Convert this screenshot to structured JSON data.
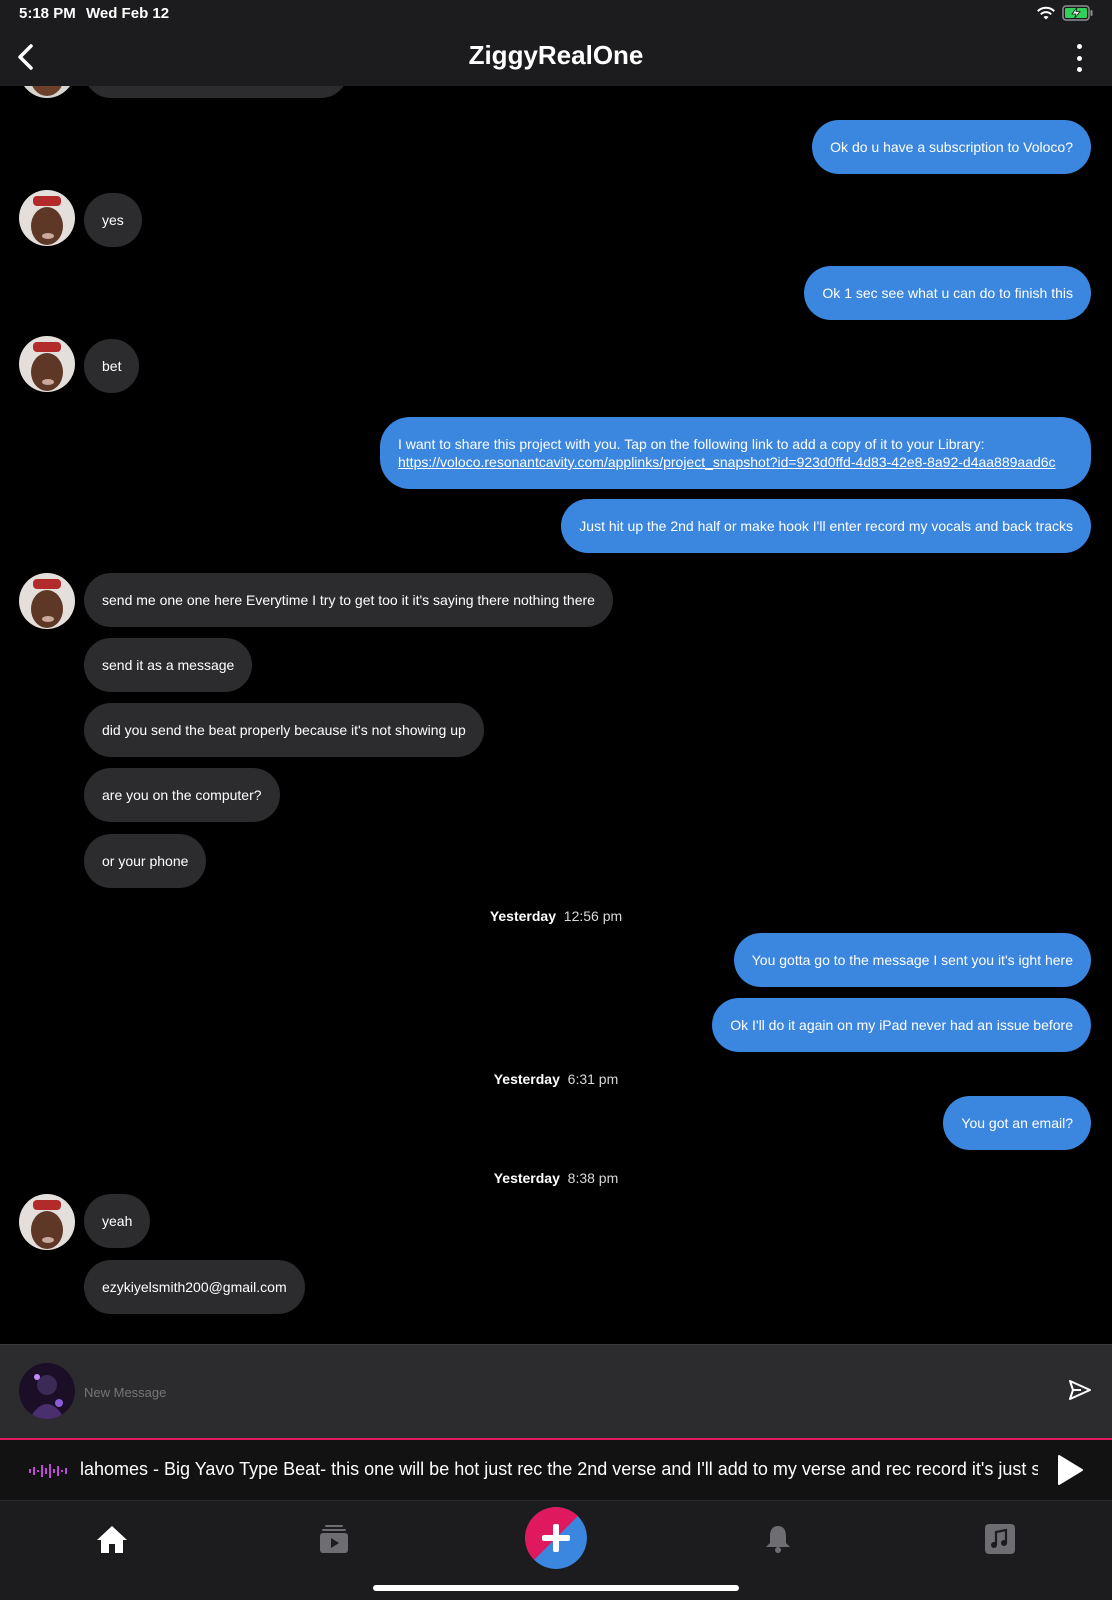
{
  "status_bar": {
    "time": "5:18 PM",
    "date": "Wed Feb 12"
  },
  "header": {
    "title": "ZiggyRealOne"
  },
  "messages": {
    "m1": "Ok do u have a subscription to Voloco?",
    "m2": "yes",
    "m3": "Ok 1 sec see what u can do to finish this",
    "m4": "bet",
    "m5_line1": "I want to share this project with you. Tap on the following link to add a copy of it to your Library:",
    "m5_link": "https://voloco.resonantcavity.com/applinks/project_snapshot?id=923d0ffd-4d83-42e8-8a92-d4aa889aad6c",
    "m6": "Just hit up the 2nd half or make hook I'll enter record my vocals and back tracks",
    "m7": "send me one one here Everytime I try to get too it it's saying there nothing there",
    "m8": "send it as a message",
    "m9": "did you send the beat properly because it's not showing up",
    "m10": "are you on the computer?",
    "m11": "or your phone",
    "ts1_day": "Yesterday",
    "ts1_time": "12:56 pm",
    "m12": "You gotta go to the message I sent you it's ight here",
    "m13": "Ok I'll do it again on my iPad never had an issue before",
    "ts2_day": "Yesterday",
    "ts2_time": "6:31 pm",
    "m14": "You got an email?",
    "ts3_day": "Yesterday",
    "ts3_time": "8:38 pm",
    "m15": "yeah",
    "m16": "ezykiyelsmith200@gmail.com"
  },
  "composer": {
    "placeholder": "New Message"
  },
  "player": {
    "track": "lahomes - Big Yavo Type Beat- this one will be hot just rec the 2nd verse and I'll add to my verse and rec record it's just sw"
  },
  "colors": {
    "outgoing": "#3b86df",
    "incoming": "#2c2c2e",
    "accent_pink": "#e0185d",
    "accent_blue": "#3b86df"
  },
  "icons": [
    "back-chevron-icon",
    "more-vertical-icon",
    "wifi-icon",
    "battery-charging-icon",
    "send-icon",
    "waveform-icon",
    "play-icon",
    "home-icon",
    "video-feed-icon",
    "plus-icon",
    "bell-icon",
    "music-note-icon"
  ]
}
